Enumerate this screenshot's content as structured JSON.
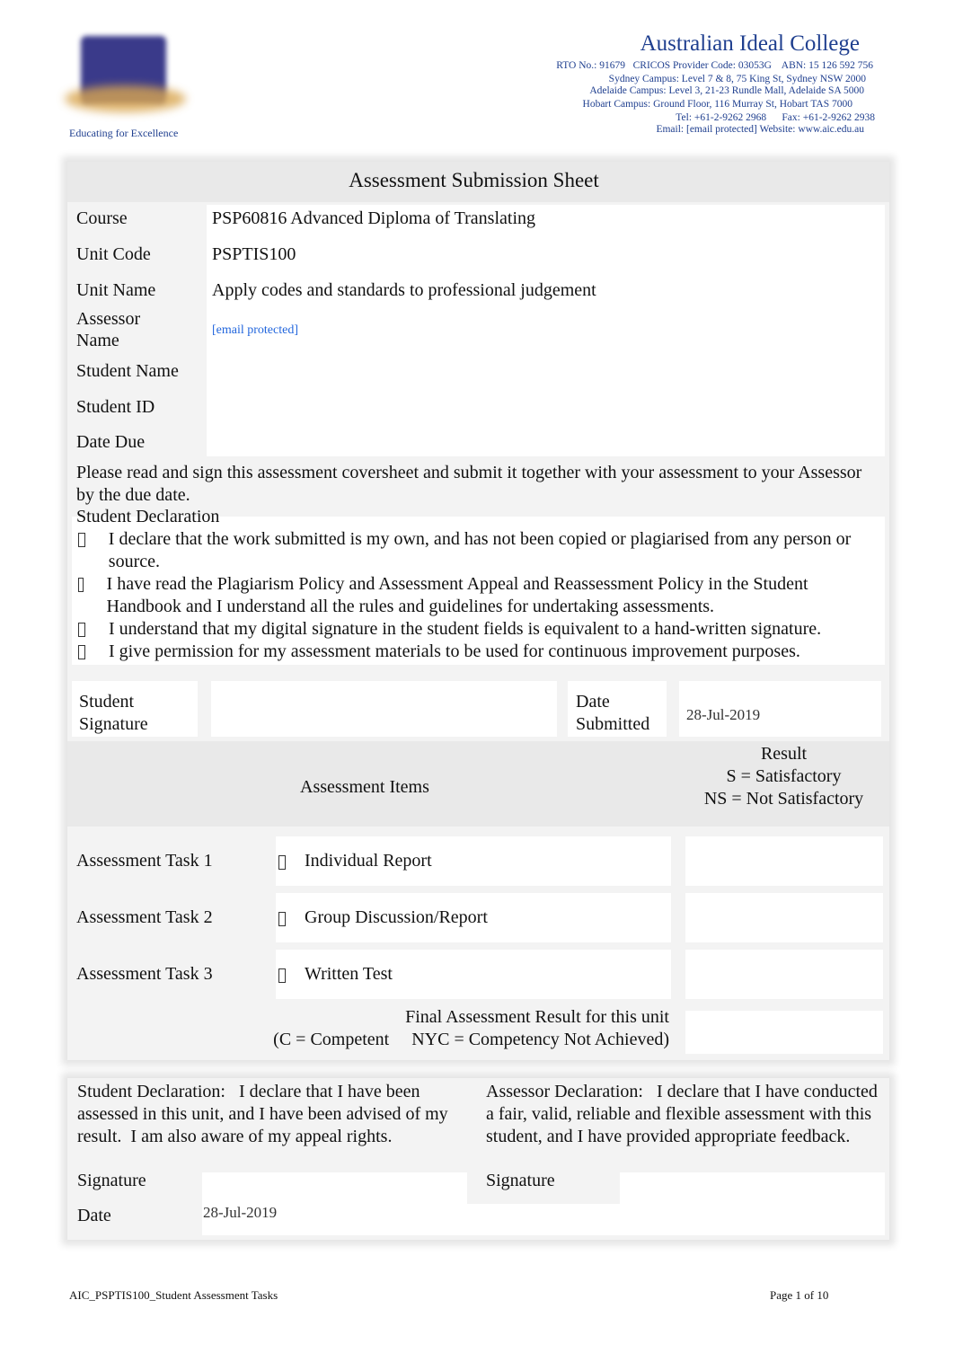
{
  "header": {
    "college_name": "Australian Ideal College",
    "tagline": "Educating for Excellence",
    "lines": [
      "RTO No.: 91679   CRICOS Provider Code: 03053G    ABN: 15 126 592 756",
      "Sydney Campus: Level 7 & 8, 75 King St, Sydney NSW 2000",
      "Adelaide Campus: Level 3, 21-23 Rundle Mall, Adelaide SA 5000",
      "Hobart Campus: Ground Floor, 116 Murray St, Hobart TAS 7000",
      "Tel: +61-2-9262 2968      Fax: +61-2-9262 2938",
      "Email: [email protected] Website: www.aic.edu.au"
    ]
  },
  "sheet": {
    "title": "Assessment Submission Sheet",
    "fields": [
      {
        "label": "Course",
        "value": "PSP60816 Advanced Diploma of Translating"
      },
      {
        "label": "Unit Code",
        "value": "PSPTIS100"
      },
      {
        "label": "Unit Name",
        "value": "Apply codes and standards to professional judgement"
      },
      {
        "label": "Assessor Name",
        "value": "[email protected]"
      },
      {
        "label": "Student Name",
        "value": ""
      },
      {
        "label": "Student ID",
        "value": ""
      },
      {
        "label": "Date Due",
        "value": ""
      }
    ],
    "instructions": "Please read and sign this assessment coversheet and submit it together with your assessment to your Assessor by the due date.",
    "declaration_title": "Student Declaration",
    "declarations": [
      "I declare that the work submitted is my own, and has not been copied or plagiarised from any person or source.",
      "I have read the Plagiarism Policy and Assessment Appeal and Reassessment Policy in the Student Handbook and I understand all the rules and guidelines for undertaking assessments.",
      "I understand that my digital signature in the student fields is equivalent to a hand-written signature.",
      "I give permission for my assessment materials to be used for continuous improvement purposes."
    ],
    "student_signature_label": "Student Signature",
    "date_submitted_label": "Date Submitted",
    "date_submitted": "28-Jul-2019",
    "items_header": "Assessment Items",
    "result_header": [
      "Result",
      "S = Satisfactory",
      "NS = Not Satisfactory"
    ],
    "tasks": [
      {
        "label": "Assessment Task 1",
        "item": "Individual Report",
        "checkbox_icon": "checkbox-icon"
      },
      {
        "label": "Assessment Task 2",
        "item": "Group Discussion/Report",
        "checkbox_icon": "checkbox-icon"
      },
      {
        "label": "Assessment Task 3",
        "item": "Written Test",
        "checkbox_icon": "checkbox-icon"
      }
    ],
    "final_result": [
      "Final Assessment Result for this unit",
      "(C = Competent     NYC = Competency Not Achieved)"
    ]
  },
  "signoff": {
    "student_declaration": "Student Declaration:   I declare that I have been assessed in this unit, and I have been advised of my result.  I am also aware of my appeal rights.",
    "assessor_declaration": "Assessor Declaration:   I declare that I have conducted a fair, valid, reliable and flexible assessment with this student, and I have provided appropriate feedback.",
    "signature_label": "Signature",
    "date_label": "Date",
    "date_value": "28-Jul-2019"
  },
  "footer": {
    "doc_name": "AIC_PSPTIS100_Student Assessment Tasks",
    "page": "Page 1 of 10"
  }
}
